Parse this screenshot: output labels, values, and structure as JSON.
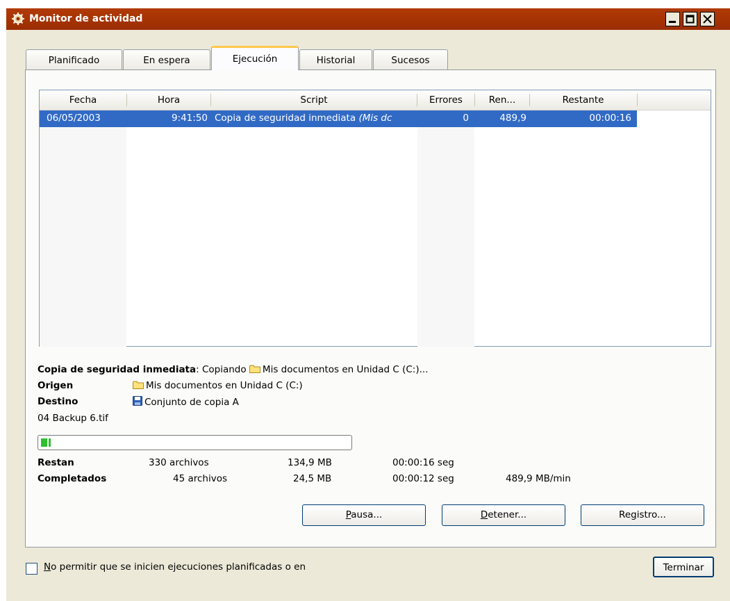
{
  "window": {
    "title": "Monitor de actividad",
    "title_color": "#a33306"
  },
  "tabs": [
    {
      "label": "Planificado",
      "active": false
    },
    {
      "label": "En espera",
      "active": false
    },
    {
      "label": "Ejecución",
      "active": true
    },
    {
      "label": "Historial",
      "active": false
    },
    {
      "label": "Sucesos",
      "active": false
    }
  ],
  "table": {
    "columns": [
      "Fecha",
      "Hora",
      "Script",
      "Errores",
      "Ren...",
      "Restante"
    ],
    "rows": [
      {
        "fecha": "06/05/2003",
        "hora": "9:41:50",
        "script": "Copia de seguridad inmediata",
        "script_extra": "(Mis dc",
        "errores": "0",
        "ren": "489,9",
        "restante": "00:00:16",
        "selected": true
      }
    ],
    "selection_color": "#316ac5"
  },
  "status": {
    "operation_name": "Copia de seguridad inmediata",
    "operation_text": ": Copiando ",
    "operation_target": "Mis documentos en Unidad C (C:)...",
    "origen_label": "Origen",
    "origen_value": "Mis documentos en Unidad C (C:)",
    "destino_label": "Destino",
    "destino_value": "Conjunto de copia A",
    "current_file": "04 Backup 6.tif",
    "progress_fraction": 0.06
  },
  "stats": {
    "restan": {
      "label": "Restan",
      "files": "330 archivos",
      "size": "134,9 MB",
      "time": "00:00:16 seg"
    },
    "completados": {
      "label": "Completados",
      "files": "45 archivos",
      "size": "24,5 MB",
      "time": "00:00:12 seg",
      "rate": "489,9 MB/min"
    }
  },
  "buttons": {
    "pausa_first": "P",
    "pausa_rest": "ausa...",
    "detener_first": "D",
    "detener_rest": "etener...",
    "registro_a": "Re",
    "registro_u": "g",
    "registro_b": "istro...",
    "terminar": "Terminar"
  },
  "footer": {
    "checkbox_first": "N",
    "checkbox_rest": "o permitir que se inicien ejecuciones planificadas o en",
    "checked": false
  }
}
